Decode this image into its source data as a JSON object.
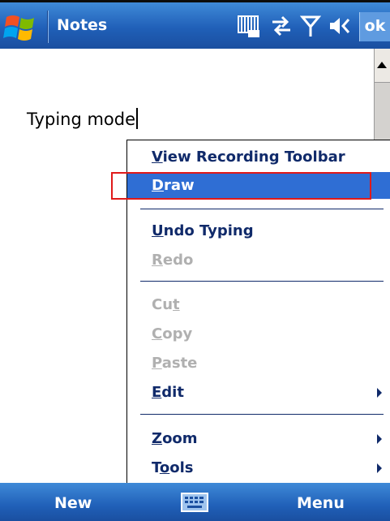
{
  "titlebar": {
    "title": "Notes",
    "ok_label": "ok",
    "icons": [
      "windows-start-icon",
      "keyboard-layout-icon",
      "connectivity-icon",
      "signal-icon",
      "volume-icon"
    ]
  },
  "note": {
    "text": "Typing mode"
  },
  "menu": {
    "items": [
      {
        "pre": "",
        "u": "V",
        "post": "iew Recording Toolbar",
        "state": "normal"
      },
      {
        "pre": "",
        "u": "D",
        "post": "raw",
        "state": "selected"
      },
      {
        "pre": "",
        "u": "U",
        "post": "ndo Typing",
        "state": "normal"
      },
      {
        "pre": "",
        "u": "R",
        "post": "edo",
        "state": "disabled"
      },
      {
        "pre": "Cu",
        "u": "t",
        "post": "",
        "state": "disabled"
      },
      {
        "pre": "",
        "u": "C",
        "post": "opy",
        "state": "disabled"
      },
      {
        "pre": "",
        "u": "P",
        "post": "aste",
        "state": "disabled"
      },
      {
        "pre": "",
        "u": "E",
        "post": "dit",
        "state": "normal",
        "submenu": true
      },
      {
        "pre": "",
        "u": "Z",
        "post": "oom",
        "state": "normal",
        "submenu": true
      },
      {
        "pre": "T",
        "u": "o",
        "post": "ols",
        "state": "normal",
        "submenu": true
      }
    ]
  },
  "softkeys": {
    "left": "New",
    "right": "Menu",
    "center_icon": "keyboard-icon"
  },
  "colors": {
    "titlebar": "#2060b8",
    "selection": "#2f6ed4",
    "menu_text": "#102a6a",
    "disabled_text": "#b0b0b0",
    "highlight_box": "#e01a1a"
  }
}
